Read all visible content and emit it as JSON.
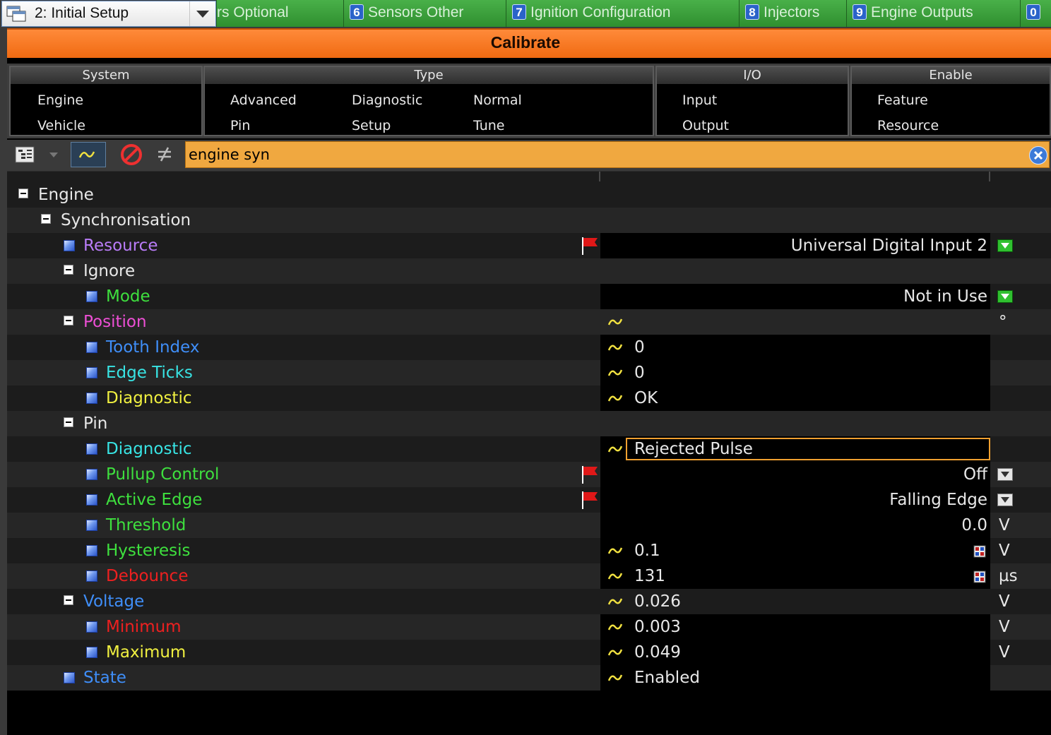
{
  "window": {
    "title": "Calibrate"
  },
  "setup_select": {
    "value": "2: Initial Setup"
  },
  "tabs": [
    {
      "num": "",
      "label": "rs Optional"
    },
    {
      "num": "6",
      "label": "Sensors Other"
    },
    {
      "num": "7",
      "label": "Ignition Configuration"
    },
    {
      "num": "8",
      "label": "Injectors"
    },
    {
      "num": "9",
      "label": "Engine Outputs"
    },
    {
      "num": "0",
      "label": ""
    }
  ],
  "filters": {
    "system": {
      "title": "System",
      "items": [
        "Engine",
        "Vehicle"
      ]
    },
    "type": {
      "title": "Type",
      "items": [
        "Advanced",
        "Diagnostic",
        "Normal",
        "Pin",
        "Setup",
        "Tune"
      ]
    },
    "io": {
      "title": "I/O",
      "items": [
        "Input",
        "Output"
      ]
    },
    "enable": {
      "title": "Enable",
      "items": [
        "Feature",
        "Resource"
      ]
    }
  },
  "search": {
    "value": "engine syn",
    "placeholder": ""
  },
  "colors": {
    "accent_orange": "#f06a12",
    "tab_green": "#3a9f3a",
    "search_bg": "#f0a840"
  },
  "icons": [
    "tree-view-icon",
    "chevron-down-icon",
    "wave-icon",
    "no-entry-icon",
    "not-equal-icon",
    "clear-icon",
    "flag-icon",
    "combo-arrow-icon",
    "grid-icon"
  ],
  "tree": {
    "engine": "Engine",
    "synchronisation": "Synchronisation",
    "resource": {
      "label": "Resource",
      "value": "Universal Digital Input 2"
    },
    "ignore": "Ignore",
    "mode": {
      "label": "Mode",
      "value": "Not in Use"
    },
    "position": {
      "label": "Position",
      "unit": "°"
    },
    "tooth_index": {
      "label": "Tooth Index",
      "value": "0"
    },
    "edge_ticks": {
      "label": "Edge Ticks",
      "value": "0"
    },
    "pos_diagnostic": {
      "label": "Diagnostic",
      "value": "OK"
    },
    "pin": "Pin",
    "pin_diagnostic": {
      "label": "Diagnostic",
      "value": "Rejected Pulse"
    },
    "pullup_control": {
      "label": "Pullup Control",
      "value": "Off"
    },
    "active_edge": {
      "label": "Active Edge",
      "value": "Falling Edge"
    },
    "threshold": {
      "label": "Threshold",
      "value": "0.0",
      "unit": "V"
    },
    "hysteresis": {
      "label": "Hysteresis",
      "value": "0.1",
      "unit": "V"
    },
    "debounce": {
      "label": "Debounce",
      "value": "131",
      "unit": "µs"
    },
    "voltage": {
      "label": "Voltage",
      "value": "0.026",
      "unit": "V"
    },
    "minimum": {
      "label": "Minimum",
      "value": "0.003",
      "unit": "V"
    },
    "maximum": {
      "label": "Maximum",
      "value": "0.049",
      "unit": "V"
    },
    "state": {
      "label": "State",
      "value": "Enabled"
    }
  }
}
